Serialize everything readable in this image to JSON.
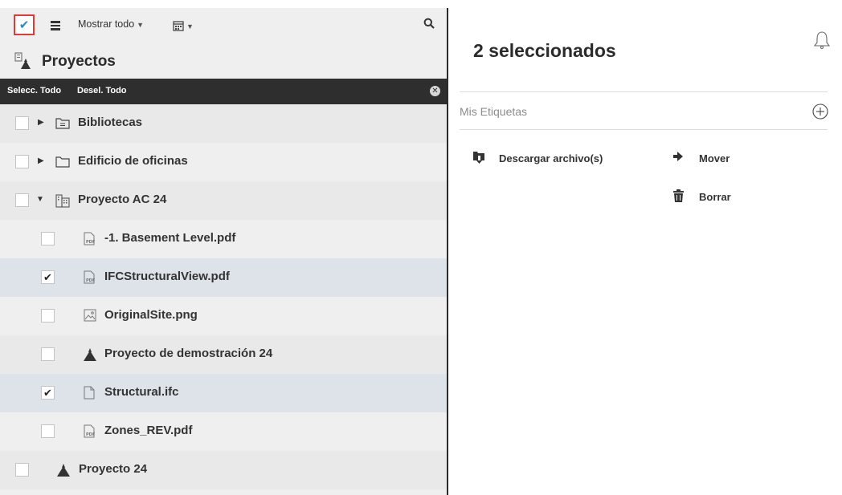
{
  "toolbar": {
    "filter_label": "Mostrar todo"
  },
  "panel": {
    "title": "Proyectos"
  },
  "selection_bar": {
    "select_all": "Selecc. Todo",
    "deselect_all": "Desel. Todo"
  },
  "tree": [
    {
      "label": "Bibliotecas",
      "checked": false,
      "icon": "library-folder-icon"
    },
    {
      "label": "Edificio de oficinas",
      "checked": false,
      "icon": "folder-icon"
    },
    {
      "label": "Proyecto AC 24",
      "checked": false,
      "icon": "building-icon"
    },
    {
      "label": "-1. Basement Level.pdf",
      "checked": false,
      "icon": "pdf-file-icon"
    },
    {
      "label": "IFCStructuralView.pdf",
      "checked": true,
      "icon": "pdf-file-icon"
    },
    {
      "label": "OriginalSite.png",
      "checked": false,
      "icon": "image-file-icon"
    },
    {
      "label": "Proyecto de demostración 24",
      "checked": false,
      "icon": "project-house-icon"
    },
    {
      "label": "Structural.ifc",
      "checked": true,
      "icon": "file-icon"
    },
    {
      "label": "Zones_REV.pdf",
      "checked": false,
      "icon": "pdf-file-icon"
    },
    {
      "label": "Proyecto 24",
      "checked": false,
      "icon": "project-house-icon"
    }
  ],
  "details": {
    "title": "2 seleccionados",
    "tags_label": "Mis Etiquetas",
    "actions": {
      "download": "Descargar archivo(s)",
      "move": "Mover",
      "delete": "Borrar"
    }
  },
  "colors": {
    "accent": "#2f86c8",
    "highlight_border": "#e53935",
    "selection_bar_bg": "#2e2e2e",
    "selected_row_bg": "#dde3e8"
  }
}
